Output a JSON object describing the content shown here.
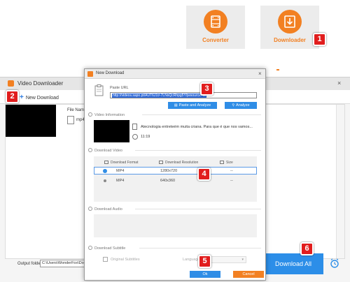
{
  "colors": {
    "accent_orange": "#f28022",
    "primary_blue": "#2f8de6",
    "callout_red": "#e11d1d"
  },
  "tiles": [
    {
      "label": "Converter",
      "icon": "film-icon"
    },
    {
      "label": "Downloader",
      "icon": "download-arrow-icon"
    }
  ],
  "video_downloader": {
    "title": "Video Downloader",
    "close_icon": "×",
    "new_download_label": "New Download",
    "file_name_label": "File Name",
    "file_format": "mp4",
    "output_folder_label": "Output folder:",
    "output_folder_path": "C:\\Users\\WonderFox\\Documents",
    "download_all_label": "Download All"
  },
  "new_download": {
    "title": "New Download",
    "close_icon": "×",
    "paste_url_label": "Paste URL",
    "url_value": "http://videos.sapo.pt/AUT6J1t/-7LNsQcRhpg5Y/jwsource=dl",
    "paste_analyze_label": "Paste and Analyze",
    "analyze_label": "Analyze",
    "video_info_label": "Video Information",
    "video_description": "Atecnologia entreteém muita criana. Para que é que nos vamos...",
    "duration": "11:19",
    "download_video_label": "Download Video",
    "columns": [
      "Download Format",
      "Download Resolution",
      "Size"
    ],
    "rows": [
      {
        "format": "MP4",
        "resolution": "1280x720",
        "size": "--",
        "selected": true
      },
      {
        "format": "MP4",
        "resolution": "640x360",
        "size": "--",
        "selected": false
      }
    ],
    "download_audio_label": "Download Audio",
    "download_subtitle_label": "Download Subtitle",
    "original_subtitles_label": "Original Subtitles",
    "language_label": "Language",
    "ok_label": "Ok",
    "cancel_label": "Cancel"
  },
  "callouts": [
    "1",
    "2",
    "3",
    "4",
    "5",
    "6"
  ]
}
